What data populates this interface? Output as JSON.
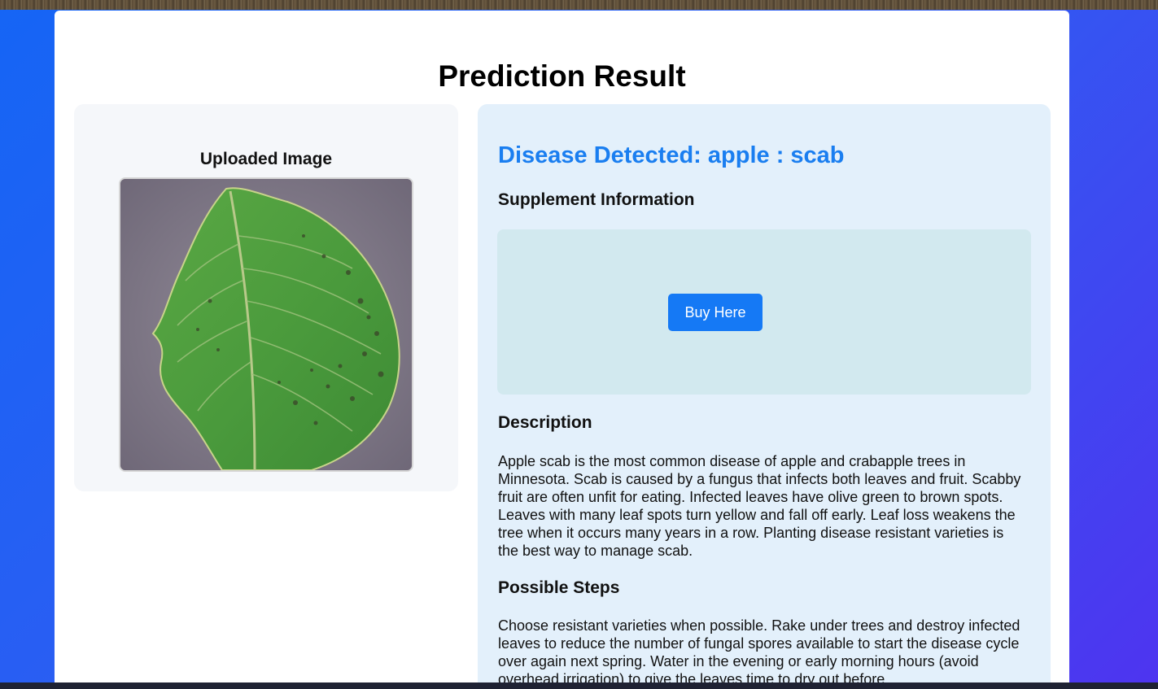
{
  "page": {
    "title": "Prediction Result"
  },
  "left_panel": {
    "title": "Uploaded Image",
    "image_alt": "apple leaf"
  },
  "result": {
    "disease_heading": "Disease Detected: apple : scab",
    "supplement_title": "Supplement Information",
    "buy_button_label": "Buy Here",
    "description_title": "Description",
    "description_text": "Apple scab is the most common disease of apple and crabapple trees in Minnesota. Scab is caused by a fungus that infects both leaves and fruit. Scabby fruit are often unfit for eating. Infected leaves have olive green to brown spots. Leaves with many leaf spots turn yellow and fall off early. Leaf loss weakens the tree when it occurs many years in a row. Planting disease resistant varieties is the best way to manage scab.",
    "steps_title": "Possible Steps",
    "steps_text": "Choose resistant varieties when possible. Rake under trees and destroy infected leaves to reduce the number of fungal spores available to start the disease cycle over again next spring. Water in the evening or early morning hours (avoid overhead irrigation) to give the leaves time to dry out before"
  },
  "colors": {
    "accent": "#1a7ef0",
    "button": "#1579f5",
    "right_panel_bg": "#e3f0fb",
    "supplement_bg": "#d2e9ef",
    "left_panel_bg": "#f5f7fa"
  }
}
